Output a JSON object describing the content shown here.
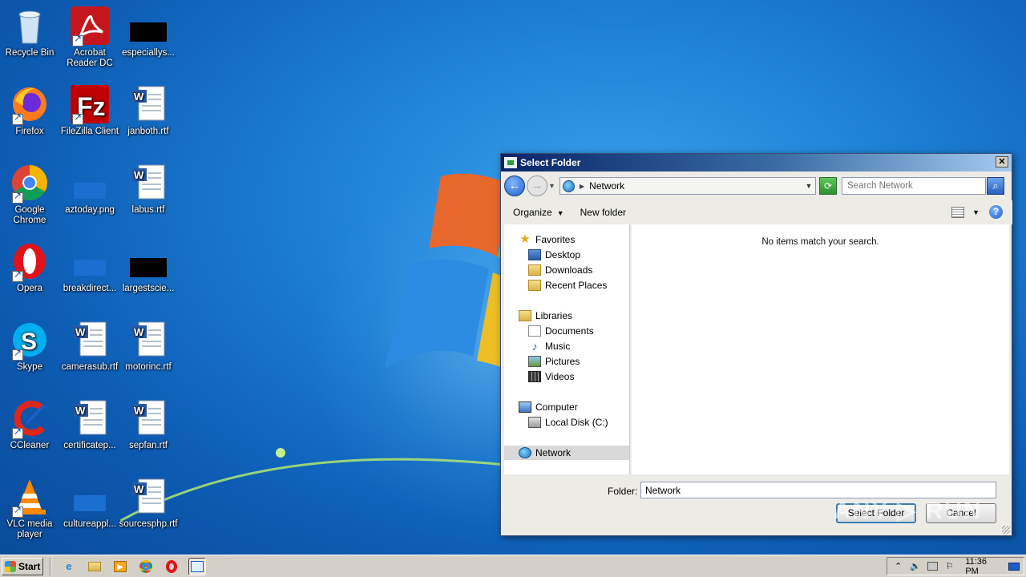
{
  "desktop": {
    "icons": [
      {
        "label": "Recycle Bin"
      },
      {
        "label": "Acrobat Reader DC"
      },
      {
        "label": "especiallys..."
      },
      {
        "label": "Firefox"
      },
      {
        "label": "FileZilla Client"
      },
      {
        "label": "janboth.rtf"
      },
      {
        "label": "Google Chrome"
      },
      {
        "label": "aztoday.png"
      },
      {
        "label": "labus.rtf"
      },
      {
        "label": "Opera"
      },
      {
        "label": "breakdirect..."
      },
      {
        "label": "largestscie..."
      },
      {
        "label": "Skype"
      },
      {
        "label": "camerasub.rtf"
      },
      {
        "label": "motorinc.rtf"
      },
      {
        "label": "CCleaner"
      },
      {
        "label": "certificatep..."
      },
      {
        "label": "sepfan.rtf"
      },
      {
        "label": "VLC media player"
      },
      {
        "label": "cultureappl..."
      },
      {
        "label": "sourcesphp.rtf"
      }
    ]
  },
  "dialog": {
    "title": "Select Folder",
    "close_label": "✕",
    "address": {
      "location": "Network"
    },
    "search": {
      "placeholder": "Search Network"
    },
    "toolbar": {
      "organize_label": "Organize",
      "new_folder_label": "New folder"
    },
    "nav": {
      "favorites": "Favorites",
      "desktop": "Desktop",
      "downloads": "Downloads",
      "recent_places": "Recent Places",
      "libraries": "Libraries",
      "documents": "Documents",
      "music": "Music",
      "pictures": "Pictures",
      "videos": "Videos",
      "computer": "Computer",
      "local_disk": "Local Disk (C:)",
      "network": "Network"
    },
    "content": {
      "empty_message": "No items match your search."
    },
    "folder": {
      "label": "Folder:",
      "value": "Network"
    },
    "buttons": {
      "select_folder": "Select Folder",
      "cancel": "Cancel"
    }
  },
  "taskbar": {
    "start_label": "Start",
    "clock": "11:36 PM"
  },
  "watermark": {
    "text": "ANY ▷ RUN"
  },
  "colors": {
    "desktop_blue": "#1c7fd4",
    "title_bar": "#0a246a",
    "selection": "#d9d9d9"
  }
}
